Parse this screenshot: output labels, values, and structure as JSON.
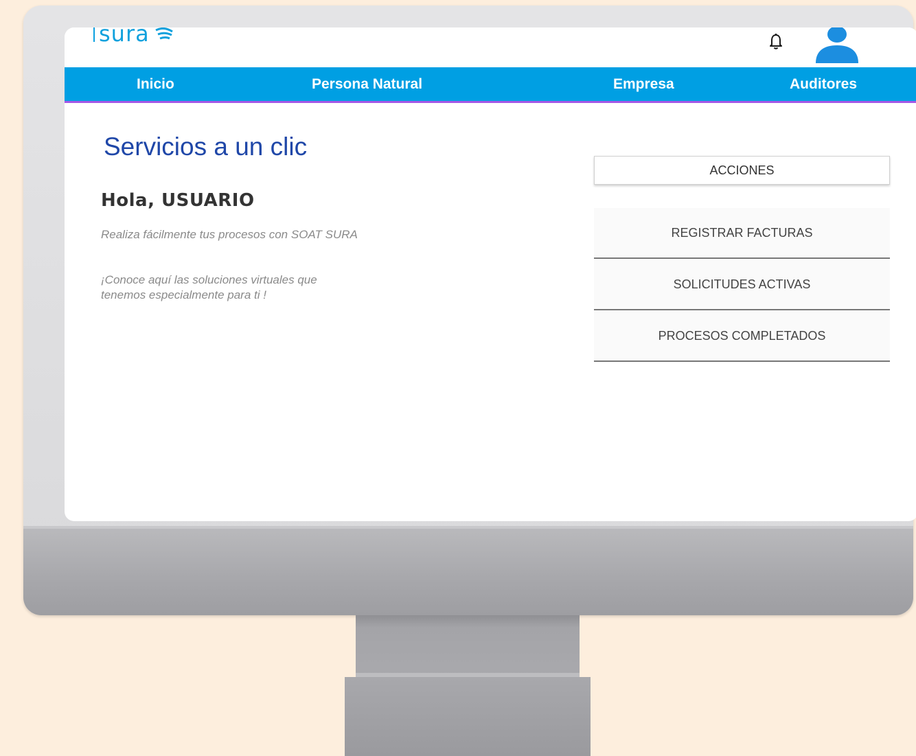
{
  "brand": {
    "logo_text": "sura"
  },
  "nav": {
    "items": [
      {
        "label": "Inicio"
      },
      {
        "label": "Persona Natural"
      },
      {
        "label": "Empresa"
      },
      {
        "label": "Auditores"
      }
    ]
  },
  "main": {
    "title": "Servicios a un clic",
    "greeting": "Hola, USUARIO",
    "description_1": "Realiza fácilmente tus procesos con SOAT SURA",
    "description_2": "¡Conoce aquí las soluciones virtuales que tenemos especialmente para ti !"
  },
  "actions": {
    "header": "ACCIONES",
    "items": [
      {
        "label": "REGISTRAR FACTURAS"
      },
      {
        "label": "SOLICITUDES ACTIVAS"
      },
      {
        "label": "PROCESOS COMPLETADOS"
      }
    ]
  },
  "colors": {
    "brand_blue": "#009fe3",
    "nav_underline": "#a557e6",
    "title_blue": "#1f47a8",
    "background": "#fdeedd"
  },
  "icons": [
    "bell-icon",
    "user-avatar-icon",
    "sura-logo"
  ]
}
